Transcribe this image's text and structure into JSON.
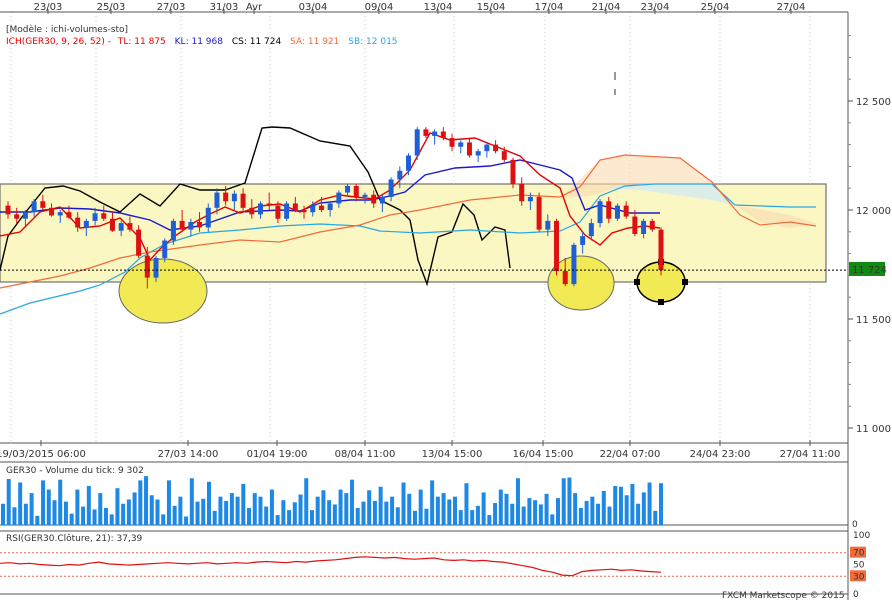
{
  "chart_data": {
    "type": "candlestick",
    "instrument": "GER30",
    "top_dates": [
      "23/03",
      "25/03",
      "27/03",
      "31/03",
      "Avr",
      "03/04",
      "09/04",
      "13/04",
      "15/04",
      "17/04",
      "21/04",
      "23/04",
      "25/04",
      "27/04"
    ],
    "bottom_dates": [
      "19/03/2015 06:00",
      "27/03 14:00",
      "01/04 19:00",
      "08/04 11:00",
      "13/04 15:00",
      "16/04 15:00",
      "22/04 07:00",
      "24/04 23:00",
      "27/04 11:00"
    ],
    "y_ticks": [
      "12 500",
      "12 000",
      "11 500",
      "11 000"
    ],
    "y_tick_values": [
      12500,
      12000,
      11500,
      11000
    ],
    "ylim": [
      10980,
      12870
    ],
    "last_price_label": "11 724",
    "last_price": 11724,
    "model_label": "[Modèle : ichi-volumes-sto]",
    "ichimoku": {
      "label": "ICH(GER30, 9, 26, 52) -",
      "tl": {
        "label": "TL: 11 875",
        "color": "#e60000"
      },
      "kl": {
        "label": "KL: 11 968",
        "color": "#1a1acc"
      },
      "cs": {
        "label": "CS: 11 724",
        "color": "#000000"
      },
      "sa": {
        "label": "SA: 11 921",
        "color": "#f26b3a"
      },
      "sb": {
        "label": "SB: 12 015",
        "color": "#29a7e0"
      }
    },
    "colors": {
      "up": "#1f5fd6",
      "down": "#dd1111",
      "band_fill": "#fbf7c2",
      "ellipse": "#f2ea55",
      "volume": "#1e88e5",
      "rsi": "#dd1111"
    },
    "volume": {
      "label": "GER30 - Volume du tick: 9 302",
      "y_ticks": [
        "0"
      ],
      "values": [
        3.0,
        6.5,
        2.5,
        6.0,
        3.0,
        4.5,
        1.3,
        6.3,
        5.0,
        3.5,
        6.4,
        3.3,
        1.6,
        5.0,
        2.6,
        5.5,
        2.2,
        4.5,
        2.4,
        1.5,
        5.2,
        3.0,
        3.6,
        4.6,
        6.3,
        6.9,
        4.2,
        3.6,
        1.5,
        6.3,
        2.7,
        4.0,
        1.2,
        6.6,
        3.3,
        3.7,
        6.1,
        2.0,
        4.0,
        3.4,
        4.5,
        4.0,
        5.8,
        2.4,
        4.5,
        4.0,
        2.6,
        5.0,
        1.4,
        3.5,
        2.1,
        3.2,
        4.3,
        6.6,
        2.1,
        4.0,
        4.9,
        3.5,
        2.9,
        5.0,
        4.5,
        6.4,
        2.4,
        3.3,
        4.9,
        3.4,
        5.4,
        3.3,
        4.0,
        2.5,
        6.0,
        4.4,
        2.0,
        5.0,
        2.3,
        6.3,
        4.0,
        4.5,
        3.6,
        4.0,
        2.1,
        5.9,
        2.1,
        2.7,
        4.6,
        1.4,
        3.1,
        5.0,
        4.4,
        3.0,
        6.6,
        2.6,
        3.8,
        3.5,
        2.9,
        4.4,
        1.5,
        3.8,
        6.6,
        6.7,
        4.5,
        2.4,
        3.4,
        4.0,
        3.0,
        4.8,
        2.6,
        5.5,
        5.4,
        4.2,
        5.8,
        3.0,
        4.6,
        6.0,
        2.0,
        5.9
      ]
    },
    "rsi": {
      "label": "RSI(GER30.Clôture, 21): 37,39",
      "y_ticks": [
        "100",
        "70",
        "50",
        "30",
        "0"
      ],
      "y_tick_values": [
        100,
        70,
        50,
        30,
        0
      ],
      "levels": [
        30,
        70
      ]
    },
    "watermark": "FXCM Marketscope © 2015"
  }
}
